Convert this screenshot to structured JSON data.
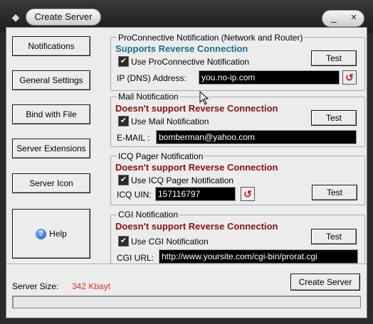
{
  "window": {
    "title": "Create Server",
    "minimize_symbol": "_",
    "close_symbol": "×",
    "app_icon": "builder-icon"
  },
  "sidebar": {
    "items": [
      {
        "label": "Notifications"
      },
      {
        "label": "General Settings"
      },
      {
        "label": "Bind with File"
      },
      {
        "label": "Server Extensions"
      },
      {
        "label": "Server Icon"
      }
    ],
    "help_label": "Help",
    "help_icon": "question-icon"
  },
  "proconnective": {
    "title": "ProConnective Notification (Network and Router)",
    "support": "Supports Reverse Connection",
    "checkbox_label": "Use ProConnective Notification",
    "checked": true,
    "field_label": "IP (DNS) Address:",
    "value": "you.no-ip.com",
    "test_label": "Test"
  },
  "mail": {
    "title": "Mail Notification",
    "support": "Doesn't support Reverse Connection",
    "checkbox_label": "Use Mail Notification",
    "checked": true,
    "field_label": "E-MAIL :",
    "value": "bomberman@yahoo.com",
    "test_label": "Test"
  },
  "icq": {
    "title": "ICQ Pager Notification",
    "support": "Doesn't support Reverse Connection",
    "checkbox_label": "Use ICQ Pager Notification",
    "checked": true,
    "field_label": "ICQ UIN:",
    "value": "157116797",
    "test_label": "Test"
  },
  "cgi": {
    "title": "CGI Notification",
    "support": "Doesn't support Reverse Connection",
    "checkbox_label": "Use CGI Notification",
    "checked": true,
    "field_label": "CGI URL:",
    "value": "http://www.yoursite.com/cgi-bin/prorat.cgi",
    "test_label": "Test"
  },
  "footer": {
    "size_label": "Server Size:",
    "size_value": "342 Kbayt",
    "create_label": "Create Server",
    "progress_fraction": 0
  },
  "colors": {
    "reverse_supported": "#1a6e8a",
    "reverse_unsupported": "#8b0f0f",
    "size_value": "#e03030"
  }
}
